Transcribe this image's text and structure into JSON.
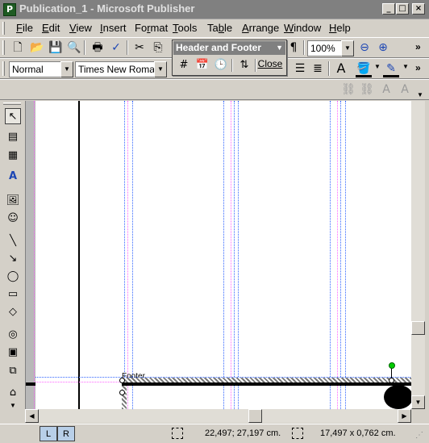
{
  "window": {
    "title": "Publication_1 - Microsoft Publisher",
    "minimize_glyph": "_",
    "maximize_glyph": "□",
    "close_glyph": "×"
  },
  "menu": [
    {
      "label": "File",
      "acc": "F",
      "rest": "ile"
    },
    {
      "label": "Edit",
      "acc": "E",
      "rest": "dit"
    },
    {
      "label": "View",
      "acc": "V",
      "rest": "iew"
    },
    {
      "label": "Insert",
      "acc": "I",
      "rest": "nsert"
    },
    {
      "label": "Format",
      "acc": "F",
      "rest": "o",
      "acc2": "r",
      "rest2": "mat"
    },
    {
      "label": "Tools",
      "acc": "T",
      "rest": "ools"
    },
    {
      "label": "Table",
      "acc": "T",
      "rest": "a",
      "acc2": "b",
      "rest2": "le"
    },
    {
      "label": "Arrange",
      "acc": "A",
      "rest": "rrange"
    },
    {
      "label": "Window",
      "acc": "W",
      "rest": "indow"
    },
    {
      "label": "Help",
      "acc": "H",
      "rest": "elp"
    }
  ],
  "standard_toolbar": {
    "zoom_value": "100%"
  },
  "format_toolbar": {
    "style_value": "Normal",
    "font_value": "Times New Roman"
  },
  "header_footer_toolbar": {
    "title": "Header and Footer",
    "close_label": "Close"
  },
  "page": {
    "footer_label": "Footer"
  },
  "status": {
    "position": "22,497; 27,197 cm.",
    "size": "17,497 x  0,762 cm.",
    "page_left": "L",
    "page_right": "R"
  },
  "colors": {
    "title_bar_inactive": "#808080",
    "chrome": "#d4d0c8",
    "guide_blue": "#3366ff",
    "guide_pink": "#ff66ff",
    "footer_marker": "#00aa00"
  }
}
